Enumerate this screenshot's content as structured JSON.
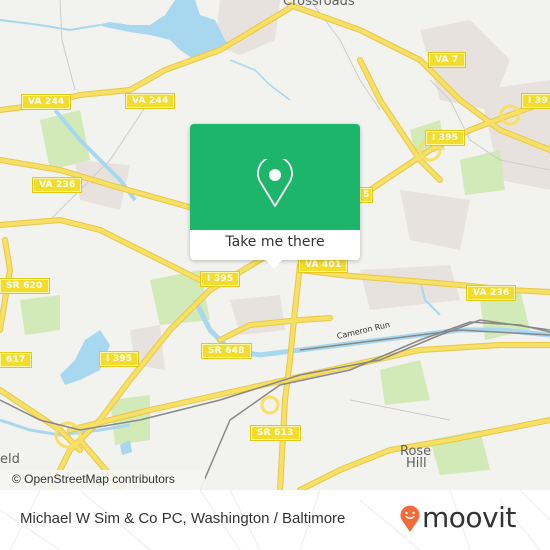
{
  "map": {
    "place_labels": [
      {
        "id": "crossroads",
        "text": "Crossroads"
      },
      {
        "id": "rose",
        "text": "Rose"
      },
      {
        "id": "hill",
        "text": "Hill"
      },
      {
        "id": "eld",
        "text": "eld"
      }
    ],
    "road_shields": [
      {
        "id": "va244-west",
        "text": "VA 244"
      },
      {
        "id": "va244-east",
        "text": "VA 244"
      },
      {
        "id": "va236-west",
        "text": "VA 236"
      },
      {
        "id": "va7",
        "text": "VA 7"
      },
      {
        "id": "i395-east-edge",
        "text": "I 39"
      },
      {
        "id": "i395-northeast",
        "text": "I 395"
      },
      {
        "id": "i395-partial",
        "text": "5"
      },
      {
        "id": "i395-center",
        "text": "I 395"
      },
      {
        "id": "va401",
        "text": "VA 401"
      },
      {
        "id": "va236-east",
        "text": "VA 236"
      },
      {
        "id": "sr620",
        "text": "SR 620"
      },
      {
        "id": "sr617",
        "text": "617"
      },
      {
        "id": "i395-southwest",
        "text": "I 395"
      },
      {
        "id": "sr648",
        "text": "SR 648"
      },
      {
        "id": "sr613",
        "text": "SR 613"
      }
    ],
    "water_labels": [
      {
        "id": "cameron-run",
        "text": "Cameron Run"
      }
    ],
    "attribution": "© OpenStreetMap contributors",
    "colors": {
      "land": "#f2f2ee",
      "water": "#a8d8ef",
      "park": "#cfe8b4",
      "road": "#f7e064",
      "shield": "#f4dc2c",
      "urban": "#e9e3e1"
    }
  },
  "popup": {
    "button_label": "Take me there",
    "accent_color": "#1db56a",
    "icon": "map-pin-icon"
  },
  "footer": {
    "title": "Michael W Sim & Co PC, Washington / Baltimore",
    "brand": "moovit",
    "brand_color": "#f26b3a"
  }
}
